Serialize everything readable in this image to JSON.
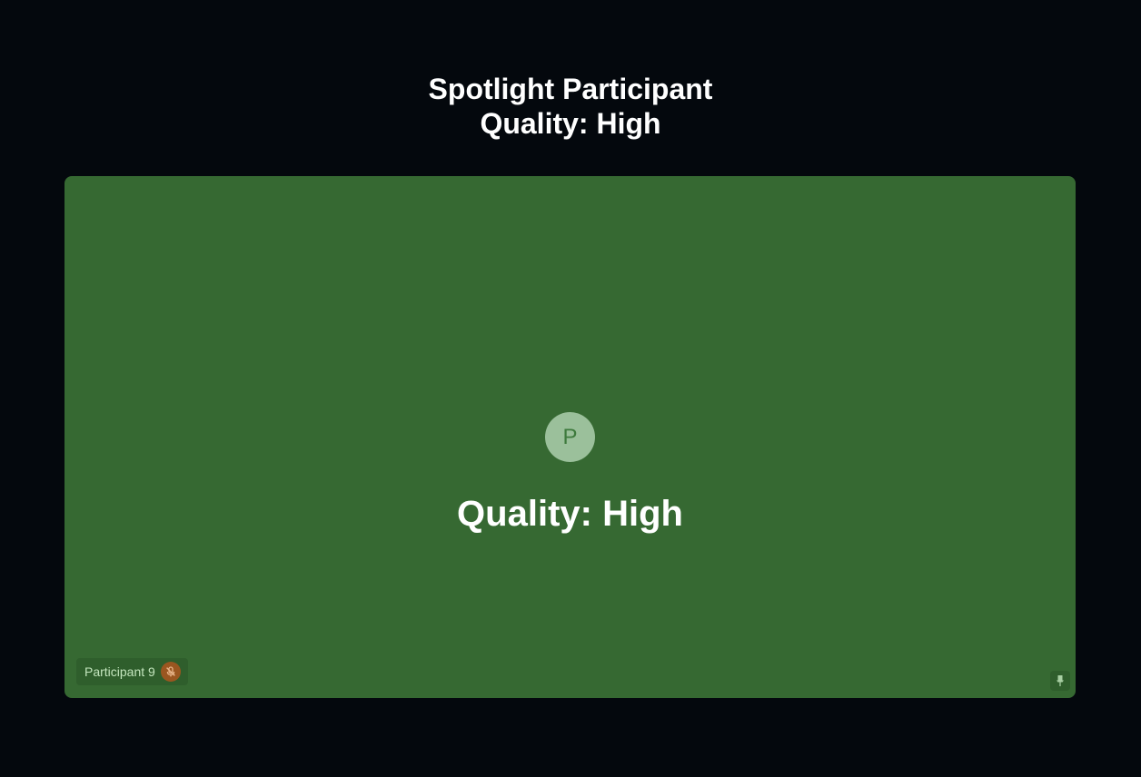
{
  "header": {
    "title": "Spotlight Participant",
    "subtitle": "Quality: High"
  },
  "tile": {
    "avatar_initial": "P",
    "quality_label": "Quality: High",
    "participant_name": "Participant 9",
    "mic_state": "muted",
    "icons": {
      "mic": "mic-off-icon",
      "pin": "pin-icon"
    },
    "colors": {
      "background": "#366932",
      "avatar": "#9bc09b",
      "mic_badge": "#9a5620"
    }
  }
}
